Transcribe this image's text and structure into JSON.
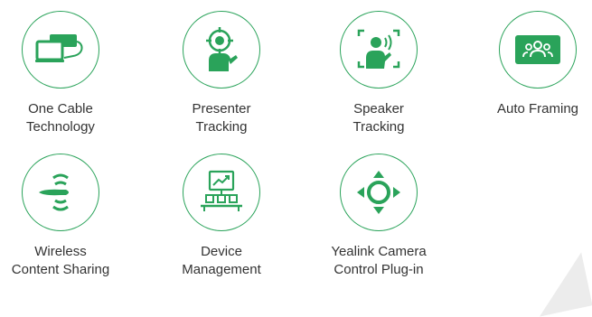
{
  "accent_color": "#2aa35a",
  "features": [
    {
      "icon": "cable-laptop-icon",
      "line1": "One Cable",
      "line2": "Technology"
    },
    {
      "icon": "presenter-tracking-icon",
      "line1": "Presenter",
      "line2": "Tracking"
    },
    {
      "icon": "speaker-tracking-icon",
      "line1": "Speaker",
      "line2": "Tracking"
    },
    {
      "icon": "auto-framing-icon",
      "line1": "Auto Framing",
      "line2": ""
    },
    {
      "icon": "wireless-sharing-icon",
      "line1": "Wireless",
      "line2": "Content Sharing"
    },
    {
      "icon": "device-management-icon",
      "line1": "Device",
      "line2": "Management"
    },
    {
      "icon": "camera-control-icon",
      "line1": "Yealink Camera",
      "line2": "Control Plug-in"
    }
  ]
}
